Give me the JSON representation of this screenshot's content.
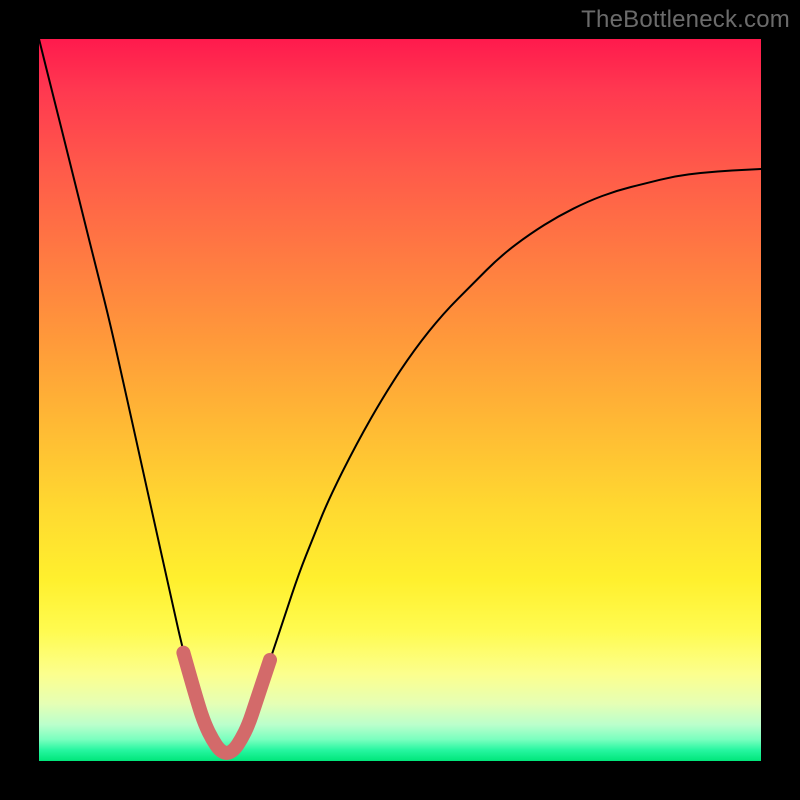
{
  "watermark": "TheBottleneck.com",
  "colors": {
    "frame": "#000000",
    "curve": "#000000",
    "emphasis": "#d36a6a",
    "gradient_top": "#ff1a4d",
    "gradient_mid": "#ffd930",
    "gradient_bottom": "#00e67a"
  },
  "chart_data": {
    "type": "line",
    "title": "",
    "xlabel": "",
    "ylabel": "",
    "x": [
      0.0,
      0.02,
      0.04,
      0.06,
      0.08,
      0.1,
      0.12,
      0.14,
      0.16,
      0.18,
      0.2,
      0.22,
      0.23,
      0.24,
      0.25,
      0.26,
      0.27,
      0.28,
      0.29,
      0.3,
      0.32,
      0.34,
      0.36,
      0.38,
      0.4,
      0.44,
      0.48,
      0.52,
      0.56,
      0.6,
      0.64,
      0.68,
      0.72,
      0.76,
      0.8,
      0.84,
      0.88,
      0.92,
      0.96,
      1.0
    ],
    "values": [
      1.0,
      0.92,
      0.84,
      0.76,
      0.68,
      0.6,
      0.51,
      0.42,
      0.33,
      0.24,
      0.15,
      0.08,
      0.05,
      0.03,
      0.015,
      0.01,
      0.015,
      0.03,
      0.05,
      0.08,
      0.14,
      0.2,
      0.26,
      0.31,
      0.36,
      0.44,
      0.51,
      0.57,
      0.62,
      0.66,
      0.7,
      0.73,
      0.755,
      0.775,
      0.79,
      0.8,
      0.81,
      0.815,
      0.818,
      0.82
    ],
    "emphasis_x_range": [
      0.205,
      0.305
    ],
    "xlim": [
      0,
      1
    ],
    "ylim": [
      0,
      1
    ],
    "notes": "Axes are unlabeled in the source. x and values are normalized to the plot box. Curve dips to a minimum near x≈0.26 then rises and flattens toward y≈0.82 at x=1. Emphasis range marks the thick pink segment around the dip."
  }
}
